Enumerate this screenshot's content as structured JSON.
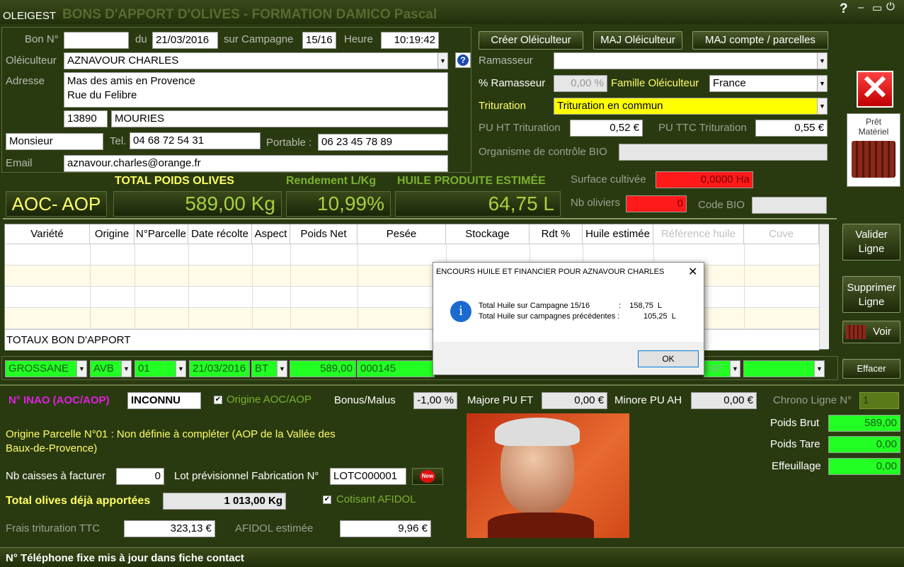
{
  "app": {
    "name": "OLEIGEST",
    "window_title": "BONS D'APPORT D'OLIVES - FORMATION DAMICO Pascal",
    "help": "?",
    "minimize": "–",
    "maximize": "▭",
    "power": "⏻"
  },
  "header": {
    "bon_label": "Bon N°",
    "bon_value": "",
    "du_label": "du",
    "date": "21/03/2016",
    "campagne_label": "sur Campagne",
    "campagne": "15/16",
    "heure_label": "Heure",
    "heure": "10:19:42",
    "oleiculteur_label": "Oléiculteur",
    "oleiculteur": "AZNAVOUR CHARLES",
    "adresse_label": "Adresse",
    "adresse_line1": "Mas des amis en Provence",
    "adresse_line2": "Rue du Felibre",
    "cp": "13890",
    "ville": "MOURIES",
    "civilite": "Monsieur",
    "tel_label": "Tel.",
    "tel": "04 68 72 54 31",
    "portable_label": "Portable :",
    "portable": "06 23 45 78 89",
    "email_label": "Email",
    "email": "aznavour.charles@orange.fr"
  },
  "buttons": {
    "creer": "Créer Oléiculteur",
    "maj": "MAJ Oléiculteur",
    "maj_compte": "MAJ compte / parcelles",
    "pret": "Prêt Matériel",
    "valider": "Valider Ligne",
    "supprimer": "Supprimer Ligne",
    "voir": "Voir",
    "effacer": "Effacer",
    "new": "New"
  },
  "right": {
    "ramasseur_label": "Ramasseur",
    "ramasseur": "",
    "pct_label": "% Ramasseur",
    "pct": "0,00 %",
    "famille_label": "Famille Oléiculteur",
    "famille": "France",
    "trituration_label": "Trituration",
    "trituration": "Trituration en commun",
    "puht_label": "PU HT Trituration",
    "puht": "0,52 €",
    "puttc_label": "PU TTC Trituration",
    "puttc": "0,55 €",
    "bio_label": "Organisme de contrôle BIO",
    "bio": "",
    "surface_label": "Surface cultivée",
    "surface": "0,0000 Ha",
    "oliviers_label": "Nb oliviers",
    "oliviers": "0",
    "codebio_label": "Code BIO",
    "codebio": ""
  },
  "totals": {
    "aoc": "AOC- AOP",
    "poids_label": "TOTAL POIDS OLIVES",
    "poids": "589,00 Kg",
    "rdt_label": "Rendement L/Kg",
    "rdt": "10,99%",
    "huile_label": "HUILE PRODUITE ESTIMÉE",
    "huile": "64,75 L"
  },
  "table": {
    "headers": [
      "Variété",
      "Origine",
      "N°Parcelle",
      "Date récolte",
      "Aspect",
      "Poids Net",
      "Pesée",
      "Stockage",
      "Rdt %",
      "Huile estimée",
      "Référence huile",
      "Cuve"
    ],
    "totaux": "TOTAUX BON D'APPORT"
  },
  "entry": {
    "variete": "GROSSANE",
    "origine": "AVB",
    "parcelle": "01",
    "date": "21/03/2016",
    "aspect": "BT",
    "poids": "589,00",
    "pesee": "000145",
    "ref_partial": "ME"
  },
  "dialog": {
    "title": "ENCOURS HUILE ET FINANCIER POUR AZNAVOUR CHARLES",
    "line1_label": "Total Huile sur Campagne 15/16",
    "line1_value": ":    158,75  L",
    "line2_label": "Total Huile sur  campagnes précédentes :",
    "line2_value": "105,25  L",
    "ok": "OK",
    "close": "✕"
  },
  "bottom": {
    "inao_label": "N° INAO (AOC/AOP)",
    "inao": "INCONNU",
    "origine_aoc": "Origine AOC/AOP",
    "bonus_label": "Bonus/Malus",
    "bonus": "-1,00 %",
    "majore_label": "Majore PU FT",
    "majore": "0,00 €",
    "minore_label": "Minore PU AH",
    "minore": "0,00 €",
    "chrono_label": "Chrono Ligne N°",
    "chrono": "1",
    "origine_parcelle": "Origine Parcelle N°01 : Non définie à compléter (AOP  de la Vallée des Baux-de-Provence)",
    "poids_brut_label": "Poids Brut",
    "poids_brut": "589,00",
    "poids_tare_label": "Poids Tare",
    "poids_tare": "0,00",
    "effeuillage_label": "Effeuillage",
    "effeuillage": "0,00",
    "caisses_label": "Nb caisses à facturer",
    "caisses": "0",
    "lot_label": "Lot prévisionnel Fabrication N°",
    "lot": "LOTC000001",
    "total_olives_label": "Total olives déjà apportées",
    "total_olives": "1 013,00 Kg",
    "cotisant": "Cotisant AFIDOL",
    "frais_label": "Frais trituration TTC",
    "frais": "323,13 €",
    "afidol_label": "AFIDOL estimée",
    "afidol": "9,96 €"
  },
  "status": "N° Téléphone fixe mis à jour dans fiche contact"
}
